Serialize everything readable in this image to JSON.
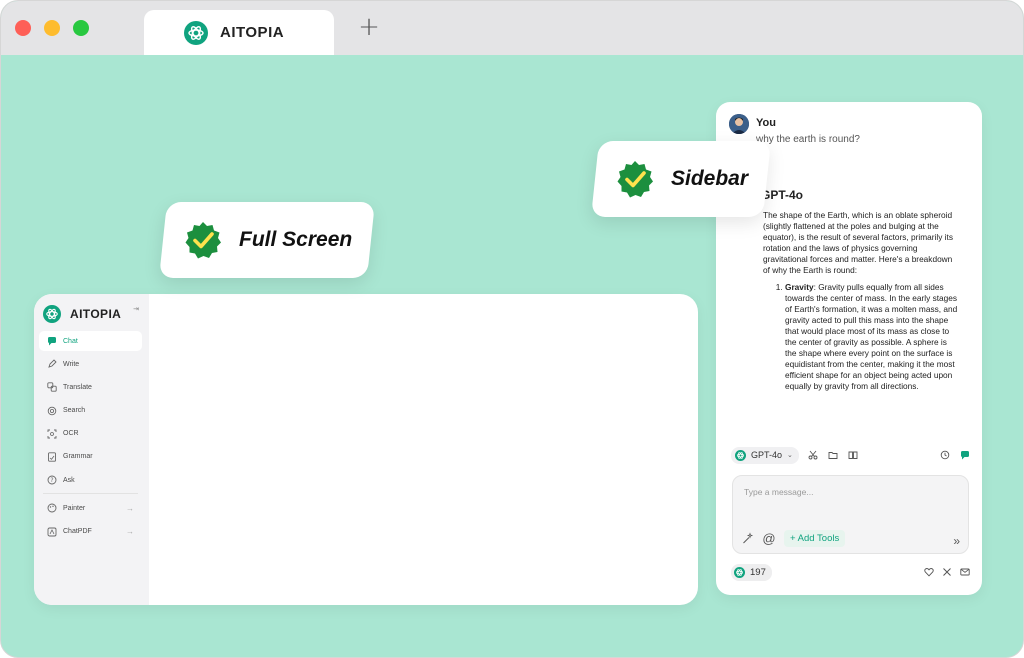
{
  "browser": {
    "tab_title": "AITOPIA",
    "new_tab_symbol": "+"
  },
  "badges": {
    "full_screen": "Full Screen",
    "sidebar": "Sidebar"
  },
  "full_screen_app": {
    "brand": "AITOPIA",
    "nav": [
      {
        "label": "Chat",
        "icon": "chat-icon",
        "active": true
      },
      {
        "label": "Write",
        "icon": "write-icon"
      },
      {
        "label": "Translate",
        "icon": "translate-icon"
      },
      {
        "label": "Search",
        "icon": "search-icon"
      },
      {
        "label": "OCR",
        "icon": "ocr-icon"
      },
      {
        "label": "Grammar",
        "icon": "grammar-icon"
      },
      {
        "label": "Ask",
        "icon": "ask-icon"
      },
      {
        "label": "Painter",
        "icon": "painter-icon"
      },
      {
        "label": "ChatPDF",
        "icon": "pdf-icon"
      }
    ]
  },
  "sidebar_app": {
    "user_name": "You",
    "user_message": "why the earth is round?",
    "model_name": "GPT-4o",
    "answer_intro": "The shape of the Earth, which is an oblate spheroid (slightly flattened at the poles and bulging at the equator), is the result of several factors, primarily its rotation and the laws of physics governing gravitational forces and matter. Here's a breakdown of why the Earth is round:",
    "answer_point_title": "Gravity",
    "answer_point_text": ": Gravity pulls equally from all sides towards the center of mass. In the early stages of Earth's formation, it was a molten mass, and gravity acted to pull this mass into the shape that would place most of its mass as close to the center of gravity as possible. A sphere is the shape where every point on the surface is equidistant from the center, making it the most efficient shape for an object being acted upon equally by gravity from all directions.",
    "model_selector": "GPT-4o",
    "input_placeholder": "Type a message...",
    "add_tools": "+ Add Tools",
    "credits": "197"
  },
  "colors": {
    "background": "#a9e6d2",
    "accent": "#10a37f"
  }
}
